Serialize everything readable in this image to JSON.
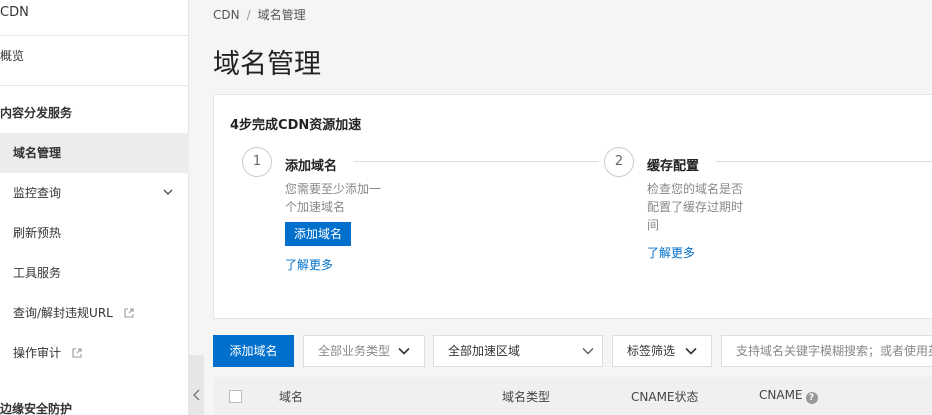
{
  "sidebar": {
    "title": "CDN",
    "overview": "概览",
    "group_content": "内容分发服务",
    "items": [
      {
        "label": "域名管理"
      },
      {
        "label": "监控查询"
      },
      {
        "label": "刷新预热"
      },
      {
        "label": "工具服务"
      },
      {
        "label": "查询/解封违规URL"
      },
      {
        "label": "操作审计"
      }
    ],
    "group_edge": "边缘安全防护"
  },
  "breadcrumb": {
    "root": "CDN",
    "sep": "/",
    "current": "域名管理"
  },
  "page": {
    "title": "域名管理"
  },
  "guide": {
    "title": "4步完成CDN资源加速",
    "steps": [
      {
        "number": "1",
        "title": "添加域名",
        "desc_lines": [
          "您需要至少添加一",
          "个加速域名"
        ],
        "button": "添加域名",
        "link": "了解更多"
      },
      {
        "number": "2",
        "title": "缓存配置",
        "desc_lines": [
          "检查您的域名是否",
          "配置了缓存过期时",
          "间"
        ],
        "link": "了解更多"
      }
    ]
  },
  "toolbar": {
    "add_button": "添加域名",
    "business_type": "全部业务类型",
    "region": "全部加速区域",
    "tag_filter": "标签筛选",
    "search_placeholder": "支持域名关键字模糊搜索；或者使用英"
  },
  "table": {
    "columns": [
      "域名",
      "域名类型",
      "CNAME状态",
      "CNAME"
    ]
  },
  "colors": {
    "primary": "#0070cc",
    "active_bg": "#ececec"
  }
}
